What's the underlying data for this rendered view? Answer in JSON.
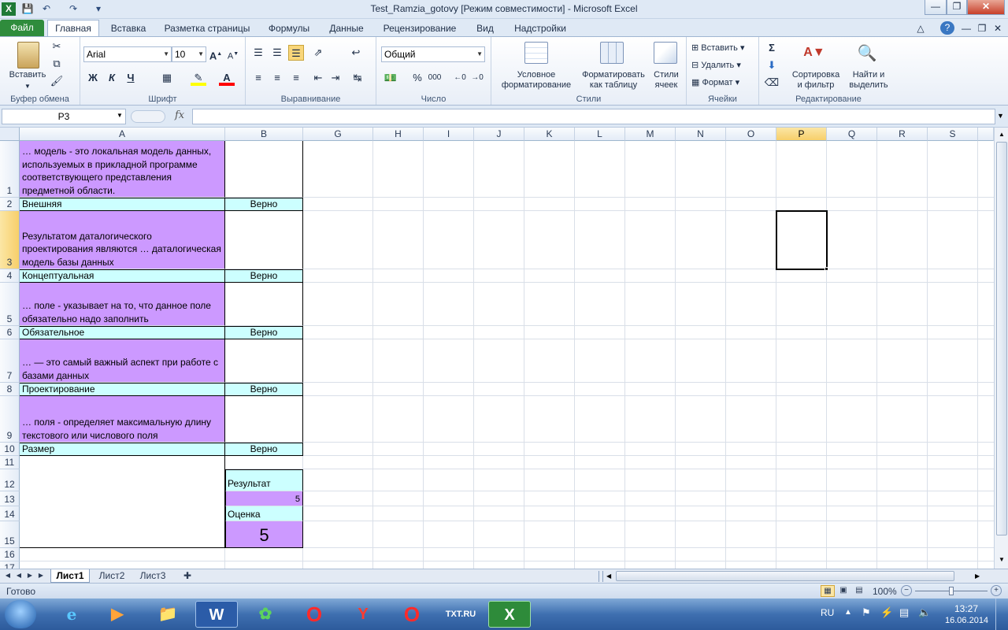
{
  "window": {
    "title": "Test_Ramzia_gotovy  [Режим совместимости]  -  Microsoft Excel",
    "quick_access": {
      "save_icon": "save-icon",
      "undo_icon": "undo-icon",
      "redo_icon": "redo-icon"
    }
  },
  "tabs": [
    "Файл",
    "Главная",
    "Вставка",
    "Разметка страницы",
    "Формулы",
    "Данные",
    "Рецензирование",
    "Вид",
    "Надстройки"
  ],
  "ribbon": {
    "clipboard": {
      "paste": "Вставить",
      "label": "Буфер обмена"
    },
    "font": {
      "name": "Arial",
      "size": "10",
      "label": "Шрифт",
      "bold": "Ж",
      "italic": "К",
      "underline": "Ч"
    },
    "alignment": {
      "label": "Выравнивание"
    },
    "number": {
      "format": "Общий",
      "label": "Число",
      "percent": "%",
      "comma": "000"
    },
    "styles": {
      "conditional": "Условное",
      "conditional2": "форматирование",
      "table": "Форматировать",
      "table2": "как таблицу",
      "cell_styles": "Стили",
      "cell_styles2": "ячеек",
      "label": "Стили"
    },
    "cells": {
      "insert": "Вставить",
      "delete": "Удалить",
      "format": "Формат",
      "label": "Ячейки"
    },
    "editing": {
      "sort": "Сортировка",
      "sort2": "и фильтр",
      "find": "Найти и",
      "find2": "выделить",
      "label": "Редактирование"
    }
  },
  "formula_bar": {
    "name_box": "P3",
    "fx": "fx",
    "content": ""
  },
  "columns": [
    "A",
    "B",
    "G",
    "H",
    "I",
    "J",
    "K",
    "L",
    "M",
    "N",
    "O",
    "P",
    "Q",
    "R",
    "S"
  ],
  "rows": [
    "1",
    "2",
    "3",
    "4",
    "5",
    "6",
    "7",
    "8",
    "9",
    "10",
    "11",
    "12",
    "13",
    "14",
    "15",
    "16",
    "17"
  ],
  "cells": {
    "A1": "… модель - это локальная модель данных, используемых в прикладной программе соответствующего представления предметной области.",
    "A2": "Внешняя",
    "B2": "Верно",
    "A3": "Результатом даталогического проектирования являются … даталогическая модель базы данных",
    "A4": "Концептуальная",
    "B4": "Верно",
    "A5": "… поле - указывает на то, что данное поле обязательно надо заполнить",
    "A6": "Обязательное",
    "B6": "Верно",
    "A7": "… — это самый важный аспект при работе с базами данных",
    "A8": "Проектирование",
    "B8": "Верно",
    "A9": "… поля - определяет максимальную длину текстового или числового поля",
    "A10": "Размер",
    "B10": "Верно",
    "B12": "Результат",
    "B13": "5",
    "B14": "Оценка",
    "B15": "5"
  },
  "sheets": [
    "Лист1",
    "Лист2",
    "Лист3"
  ],
  "status": {
    "ready": "Готово",
    "zoom": "100%"
  },
  "taskbar": {
    "lang": "RU",
    "time": "13:27",
    "date": "16.06.2014"
  },
  "colors": {
    "question_fill": "#cc99ff",
    "answer_fill": "#ccffff",
    "accent": "#2f8c3c"
  }
}
